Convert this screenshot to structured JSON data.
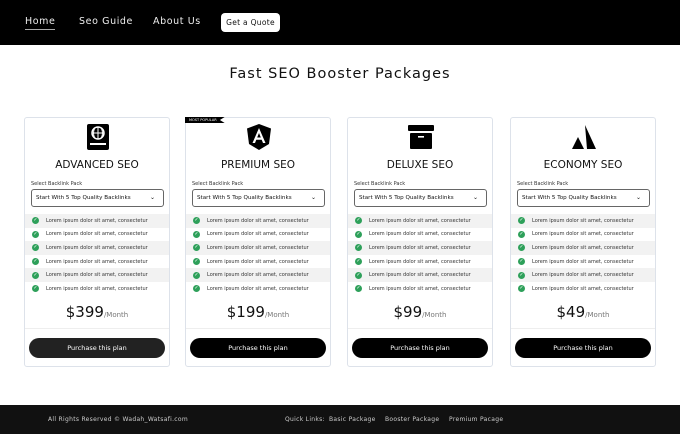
{
  "nav": {
    "home": "Home",
    "seo_guide": "Seo Guide",
    "about": "About Us",
    "quote": "Get a Quote"
  },
  "page_title": "Fast SEO Booster Packages",
  "badge": "MOST POPULAR",
  "select_label": "Select Backlink Pack",
  "select_value": "Start With 5 Top Quality  Backlinks",
  "feature": "Lorem ipsum dolor sit amet, consectetur",
  "per": "/Month",
  "button": "Purchase this plan",
  "plans": [
    {
      "name": "ADVANCED SEO",
      "price": "$399",
      "icon": "globe-book-icon"
    },
    {
      "name": "PREMIUM SEO",
      "price": "$199",
      "icon": "angular-icon"
    },
    {
      "name": "DELUXE SEO",
      "price": "$99",
      "icon": "archive-box-icon"
    },
    {
      "name": "ECONOMY SEO",
      "price": "$49",
      "icon": "atlassian-icon"
    }
  ],
  "footer": {
    "copyright": "All Rights Reserved © Wadah_Watsafi.com",
    "quick": "Quick Links:",
    "links": [
      "Basic Package",
      "Booster Package",
      "Premium Pacage"
    ]
  },
  "colors": {
    "check": "#2ea05a",
    "header": "#000000"
  }
}
